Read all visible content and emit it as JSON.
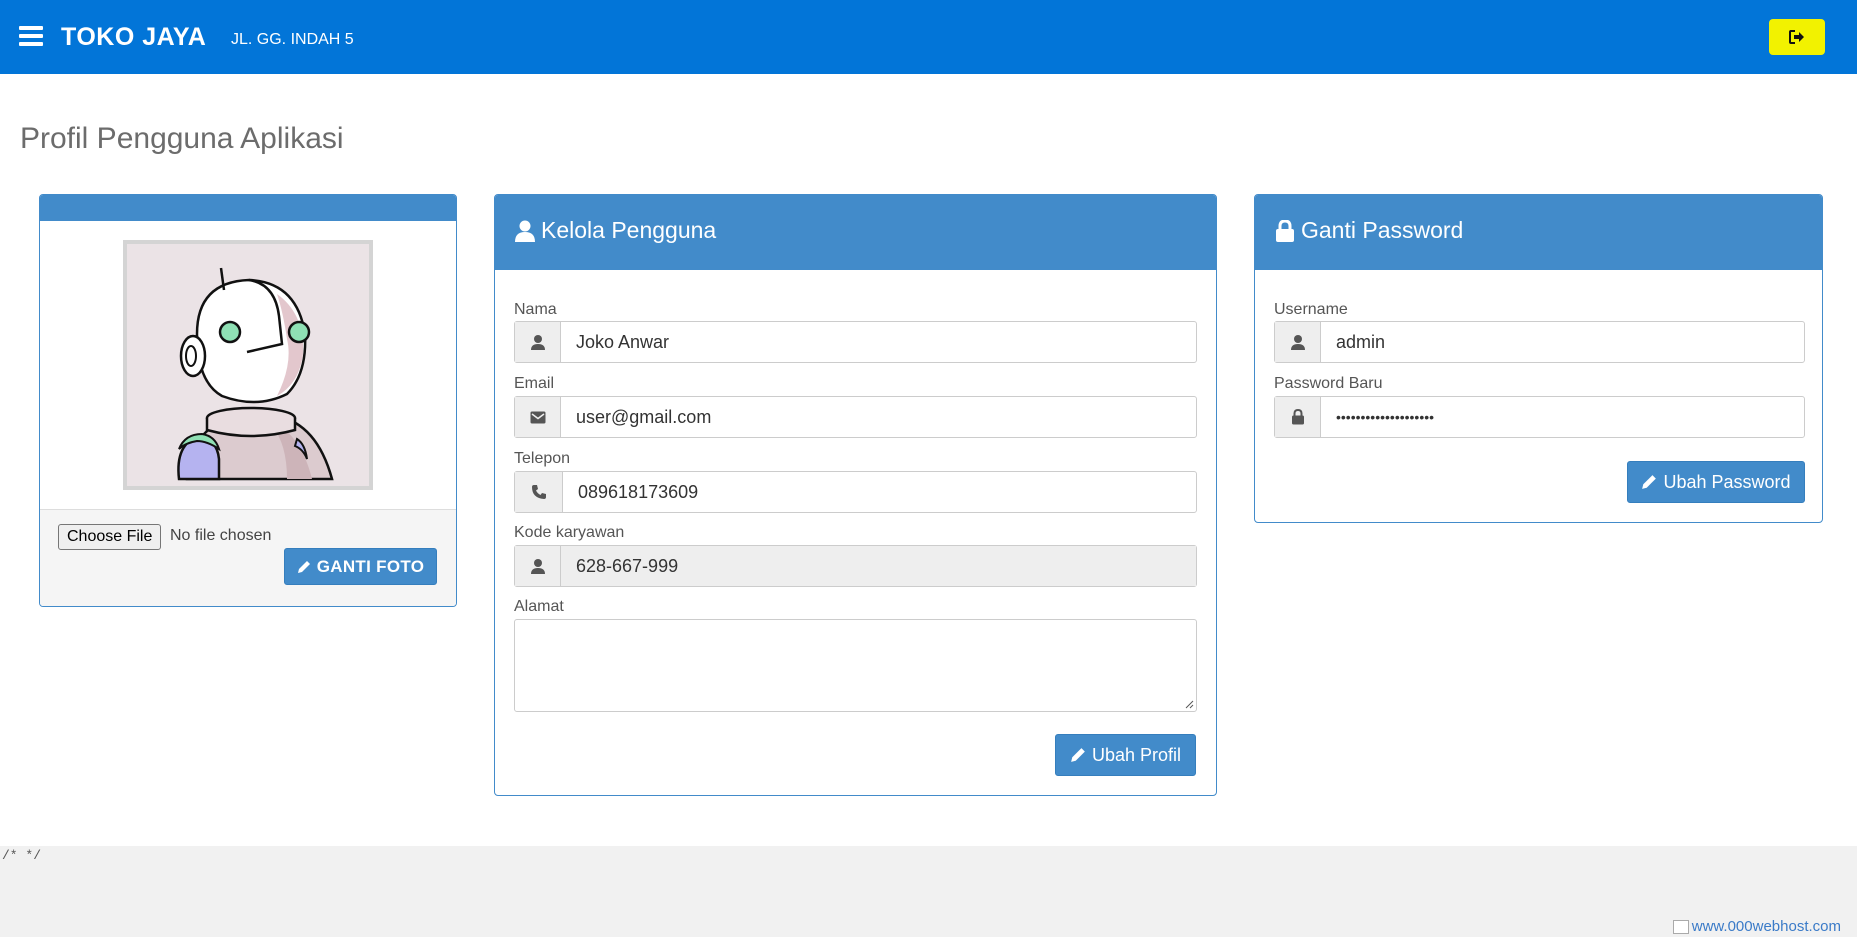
{
  "navbar": {
    "brand": "TOKO JAYA",
    "address": "JL. GG. INDAH 5",
    "background": "#0275d8",
    "logout_color": "#f2f200"
  },
  "page": {
    "title": "Profil Pengguna Aplikasi"
  },
  "photo_panel": {
    "file_button": "Choose File",
    "file_status": "No file chosen",
    "ganti_foto_label": "GANTI FOTO"
  },
  "user_panel": {
    "title": "Kelola Pengguna",
    "fields": {
      "nama": {
        "label": "Nama",
        "value": "Joko Anwar",
        "icon": "user-icon"
      },
      "email": {
        "label": "Email",
        "value": "user@gmail.com",
        "icon": "envelope-icon"
      },
      "telepon": {
        "label": "Telepon",
        "value": "089618173609",
        "icon": "phone-icon"
      },
      "kode": {
        "label": "Kode karyawan",
        "value": "628-667-999",
        "icon": "user-icon"
      },
      "alamat": {
        "label": "Alamat",
        "value": ""
      }
    },
    "submit_label": "Ubah Profil"
  },
  "pass_panel": {
    "title": "Ganti Password",
    "fields": {
      "username": {
        "label": "Username",
        "value": "admin",
        "icon": "user-icon"
      },
      "password": {
        "label": "Password Baru",
        "value": "••••••••••••••••••••",
        "icon": "lock-icon"
      }
    },
    "submit_label": "Ubah Password"
  },
  "footer": {
    "code_text": "/* */",
    "webhost_link": "www.000webhost.com"
  },
  "colors": {
    "panel_primary": "#428bca"
  }
}
